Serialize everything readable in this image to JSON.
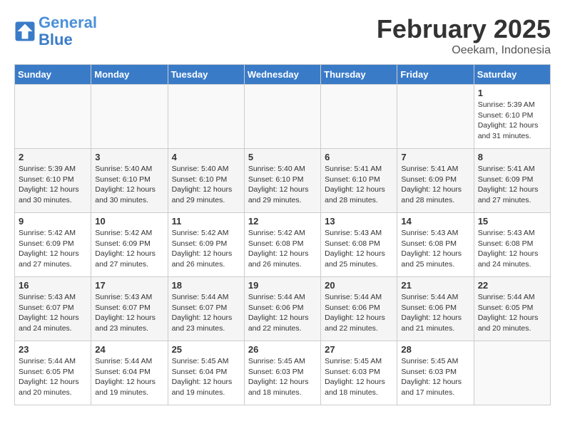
{
  "header": {
    "logo_line1": "General",
    "logo_line2": "Blue",
    "month_title": "February 2025",
    "location": "Oeekam, Indonesia"
  },
  "weekdays": [
    "Sunday",
    "Monday",
    "Tuesday",
    "Wednesday",
    "Thursday",
    "Friday",
    "Saturday"
  ],
  "weeks": [
    [
      {
        "num": "",
        "info": ""
      },
      {
        "num": "",
        "info": ""
      },
      {
        "num": "",
        "info": ""
      },
      {
        "num": "",
        "info": ""
      },
      {
        "num": "",
        "info": ""
      },
      {
        "num": "",
        "info": ""
      },
      {
        "num": "1",
        "info": "Sunrise: 5:39 AM\nSunset: 6:10 PM\nDaylight: 12 hours and 31 minutes."
      }
    ],
    [
      {
        "num": "2",
        "info": "Sunrise: 5:39 AM\nSunset: 6:10 PM\nDaylight: 12 hours and 30 minutes."
      },
      {
        "num": "3",
        "info": "Sunrise: 5:40 AM\nSunset: 6:10 PM\nDaylight: 12 hours and 30 minutes."
      },
      {
        "num": "4",
        "info": "Sunrise: 5:40 AM\nSunset: 6:10 PM\nDaylight: 12 hours and 29 minutes."
      },
      {
        "num": "5",
        "info": "Sunrise: 5:40 AM\nSunset: 6:10 PM\nDaylight: 12 hours and 29 minutes."
      },
      {
        "num": "6",
        "info": "Sunrise: 5:41 AM\nSunset: 6:10 PM\nDaylight: 12 hours and 28 minutes."
      },
      {
        "num": "7",
        "info": "Sunrise: 5:41 AM\nSunset: 6:09 PM\nDaylight: 12 hours and 28 minutes."
      },
      {
        "num": "8",
        "info": "Sunrise: 5:41 AM\nSunset: 6:09 PM\nDaylight: 12 hours and 27 minutes."
      }
    ],
    [
      {
        "num": "9",
        "info": "Sunrise: 5:42 AM\nSunset: 6:09 PM\nDaylight: 12 hours and 27 minutes."
      },
      {
        "num": "10",
        "info": "Sunrise: 5:42 AM\nSunset: 6:09 PM\nDaylight: 12 hours and 27 minutes."
      },
      {
        "num": "11",
        "info": "Sunrise: 5:42 AM\nSunset: 6:09 PM\nDaylight: 12 hours and 26 minutes."
      },
      {
        "num": "12",
        "info": "Sunrise: 5:42 AM\nSunset: 6:08 PM\nDaylight: 12 hours and 26 minutes."
      },
      {
        "num": "13",
        "info": "Sunrise: 5:43 AM\nSunset: 6:08 PM\nDaylight: 12 hours and 25 minutes."
      },
      {
        "num": "14",
        "info": "Sunrise: 5:43 AM\nSunset: 6:08 PM\nDaylight: 12 hours and 25 minutes."
      },
      {
        "num": "15",
        "info": "Sunrise: 5:43 AM\nSunset: 6:08 PM\nDaylight: 12 hours and 24 minutes."
      }
    ],
    [
      {
        "num": "16",
        "info": "Sunrise: 5:43 AM\nSunset: 6:07 PM\nDaylight: 12 hours and 24 minutes."
      },
      {
        "num": "17",
        "info": "Sunrise: 5:43 AM\nSunset: 6:07 PM\nDaylight: 12 hours and 23 minutes."
      },
      {
        "num": "18",
        "info": "Sunrise: 5:44 AM\nSunset: 6:07 PM\nDaylight: 12 hours and 23 minutes."
      },
      {
        "num": "19",
        "info": "Sunrise: 5:44 AM\nSunset: 6:06 PM\nDaylight: 12 hours and 22 minutes."
      },
      {
        "num": "20",
        "info": "Sunrise: 5:44 AM\nSunset: 6:06 PM\nDaylight: 12 hours and 22 minutes."
      },
      {
        "num": "21",
        "info": "Sunrise: 5:44 AM\nSunset: 6:06 PM\nDaylight: 12 hours and 21 minutes."
      },
      {
        "num": "22",
        "info": "Sunrise: 5:44 AM\nSunset: 6:05 PM\nDaylight: 12 hours and 20 minutes."
      }
    ],
    [
      {
        "num": "23",
        "info": "Sunrise: 5:44 AM\nSunset: 6:05 PM\nDaylight: 12 hours and 20 minutes."
      },
      {
        "num": "24",
        "info": "Sunrise: 5:44 AM\nSunset: 6:04 PM\nDaylight: 12 hours and 19 minutes."
      },
      {
        "num": "25",
        "info": "Sunrise: 5:45 AM\nSunset: 6:04 PM\nDaylight: 12 hours and 19 minutes."
      },
      {
        "num": "26",
        "info": "Sunrise: 5:45 AM\nSunset: 6:03 PM\nDaylight: 12 hours and 18 minutes."
      },
      {
        "num": "27",
        "info": "Sunrise: 5:45 AM\nSunset: 6:03 PM\nDaylight: 12 hours and 18 minutes."
      },
      {
        "num": "28",
        "info": "Sunrise: 5:45 AM\nSunset: 6:03 PM\nDaylight: 12 hours and 17 minutes."
      },
      {
        "num": "",
        "info": ""
      }
    ]
  ]
}
